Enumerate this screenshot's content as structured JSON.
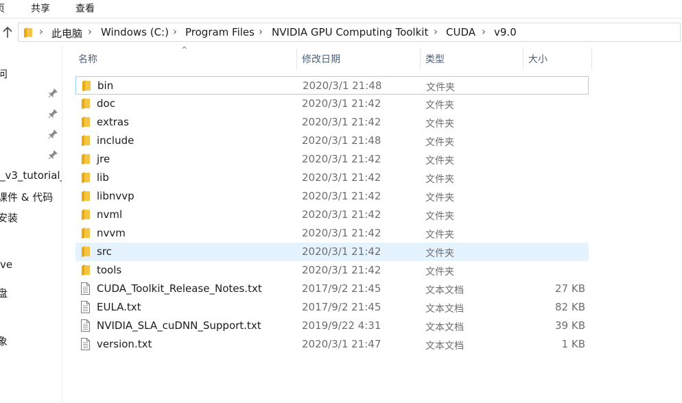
{
  "ribbon": {
    "tabs": [
      "页",
      "共享",
      "查看"
    ]
  },
  "address": {
    "crumbs": [
      "此电脑",
      "Windows (C:)",
      "Program Files",
      "NVIDIA GPU Computing Toolkit",
      "CUDA",
      "v9.0"
    ]
  },
  "sidebar": {
    "items": [
      "问",
      "_v3_tutorial_",
      "课件 & 代码",
      "安装",
      "ve",
      "盘",
      "象"
    ],
    "pinned_count": 4
  },
  "columns": {
    "name": "名称",
    "date": "修改日期",
    "type": "类型",
    "size": "大小"
  },
  "files": [
    {
      "name": "bin",
      "date": "2020/3/1 21:48",
      "type": "文件夹",
      "size": "",
      "kind": "folder",
      "state": "focus"
    },
    {
      "name": "doc",
      "date": "2020/3/1 21:42",
      "type": "文件夹",
      "size": "",
      "kind": "folder",
      "state": ""
    },
    {
      "name": "extras",
      "date": "2020/3/1 21:42",
      "type": "文件夹",
      "size": "",
      "kind": "folder",
      "state": ""
    },
    {
      "name": "include",
      "date": "2020/3/1 21:48",
      "type": "文件夹",
      "size": "",
      "kind": "folder",
      "state": ""
    },
    {
      "name": "jre",
      "date": "2020/3/1 21:42",
      "type": "文件夹",
      "size": "",
      "kind": "folder",
      "state": ""
    },
    {
      "name": "lib",
      "date": "2020/3/1 21:42",
      "type": "文件夹",
      "size": "",
      "kind": "folder",
      "state": ""
    },
    {
      "name": "libnvvp",
      "date": "2020/3/1 21:42",
      "type": "文件夹",
      "size": "",
      "kind": "folder",
      "state": ""
    },
    {
      "name": "nvml",
      "date": "2020/3/1 21:42",
      "type": "文件夹",
      "size": "",
      "kind": "folder",
      "state": ""
    },
    {
      "name": "nvvm",
      "date": "2020/3/1 21:42",
      "type": "文件夹",
      "size": "",
      "kind": "folder",
      "state": ""
    },
    {
      "name": "src",
      "date": "2020/3/1 21:42",
      "type": "文件夹",
      "size": "",
      "kind": "folder",
      "state": "hover"
    },
    {
      "name": "tools",
      "date": "2020/3/1 21:42",
      "type": "文件夹",
      "size": "",
      "kind": "folder",
      "state": ""
    },
    {
      "name": "CUDA_Toolkit_Release_Notes.txt",
      "date": "2017/9/2 21:45",
      "type": "文本文档",
      "size": "27 KB",
      "kind": "text",
      "state": ""
    },
    {
      "name": "EULA.txt",
      "date": "2017/9/2 21:45",
      "type": "文本文档",
      "size": "82 KB",
      "kind": "text",
      "state": ""
    },
    {
      "name": "NVIDIA_SLA_cuDNN_Support.txt",
      "date": "2019/9/22 4:31",
      "type": "文本文档",
      "size": "39 KB",
      "kind": "text",
      "state": ""
    },
    {
      "name": "version.txt",
      "date": "2020/3/1 21:47",
      "type": "文本文档",
      "size": "1 KB",
      "kind": "text",
      "state": ""
    }
  ],
  "colors": {
    "folder": "#f4c542",
    "focus_border": "#99d1ff",
    "hover_bg": "#e5f3ff",
    "header_text": "#4c607a"
  }
}
